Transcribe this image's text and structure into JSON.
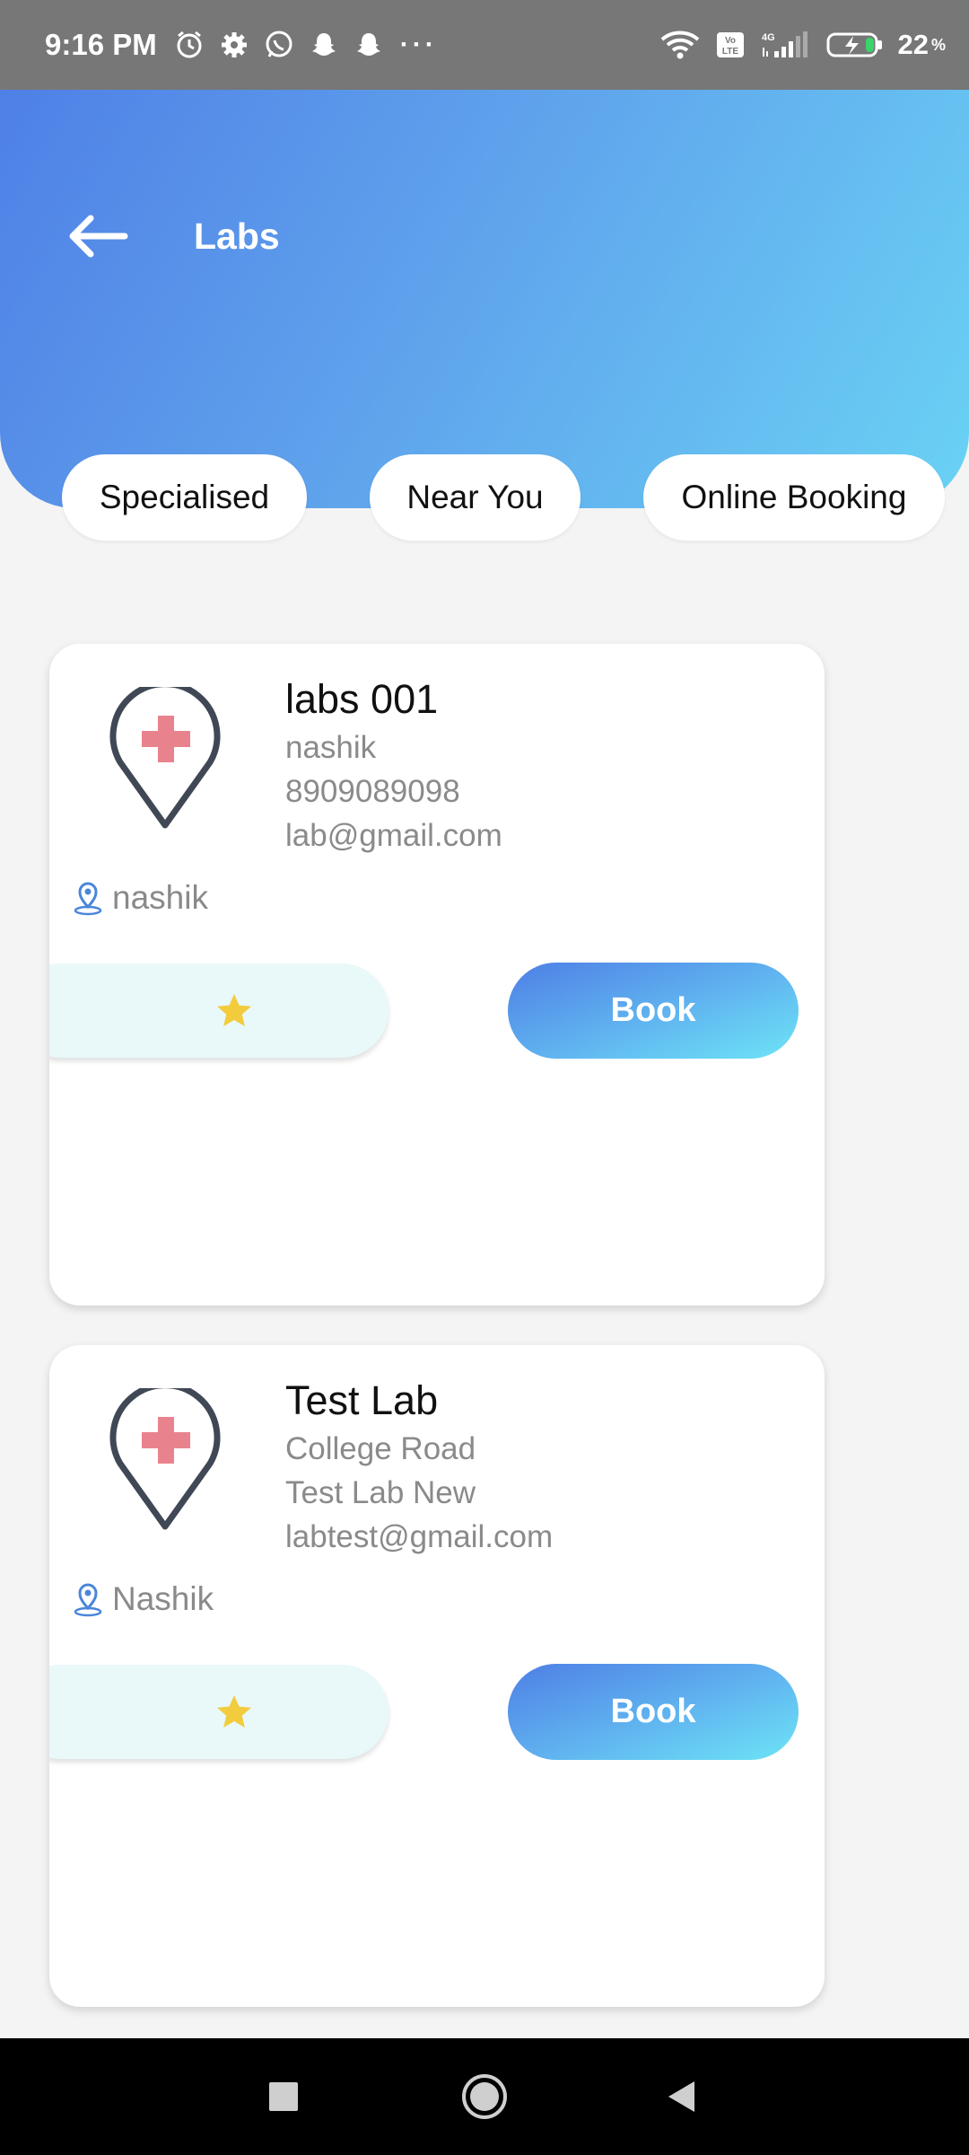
{
  "status_bar": {
    "time": "9:16 PM",
    "battery": "22",
    "battery_unit": "%",
    "network": "4G",
    "volte": "Vo LTE"
  },
  "header": {
    "title": "Labs",
    "back_icon": "arrow-left-icon"
  },
  "filters": [
    {
      "label": "Specialised"
    },
    {
      "label": "Near You"
    },
    {
      "label": "Online Booking"
    }
  ],
  "labs": [
    {
      "name": "labs 001",
      "line1": "nashik",
      "line2": "8909089098",
      "line3": "lab@gmail.com",
      "location": "nashik",
      "book_label": "Book"
    },
    {
      "name": "Test Lab",
      "line1": "College Road",
      "line2": "Test Lab New",
      "line3": "labtest@gmail.com",
      "location": "Nashik",
      "book_label": "Book"
    }
  ],
  "colors": {
    "header_start": "#4f80e6",
    "header_end": "#6ad2f4",
    "pin_stroke": "#414855",
    "cross": "#e8838d",
    "star": "#f3cc3e",
    "rating_bg": "#e9f8f8"
  }
}
